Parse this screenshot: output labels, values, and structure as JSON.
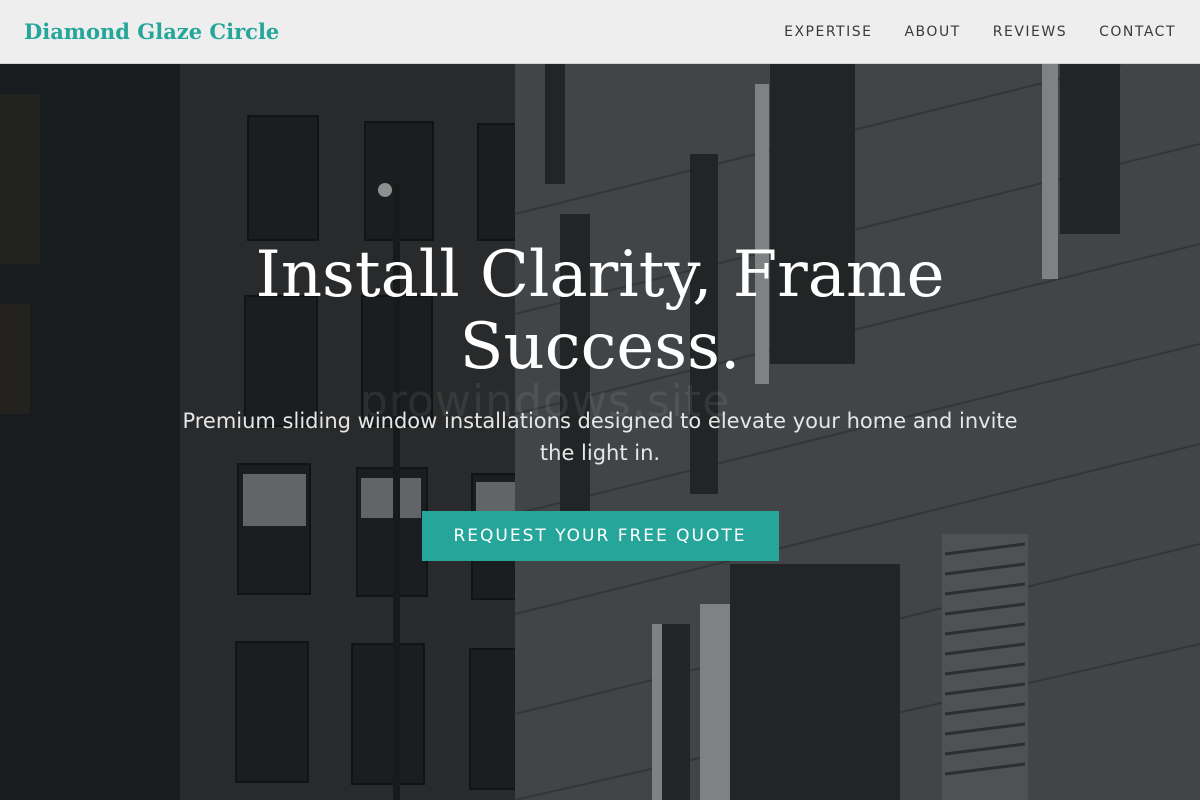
{
  "brand": {
    "name": "Diamond Glaze Circle",
    "accent_color": "#26a69a"
  },
  "nav": {
    "items": [
      {
        "label": "EXPERTISE"
      },
      {
        "label": "ABOUT"
      },
      {
        "label": "REVIEWS"
      },
      {
        "label": "CONTACT"
      }
    ]
  },
  "hero": {
    "title": "Install Clarity, Frame Success.",
    "subtitle": "Premium sliding window installations designed to elevate your home and invite the light in.",
    "cta_label": "REQUEST YOUR FREE QUOTE",
    "watermark": "prowindows.site",
    "background_image": "dark modern apartment buildings with windows"
  }
}
